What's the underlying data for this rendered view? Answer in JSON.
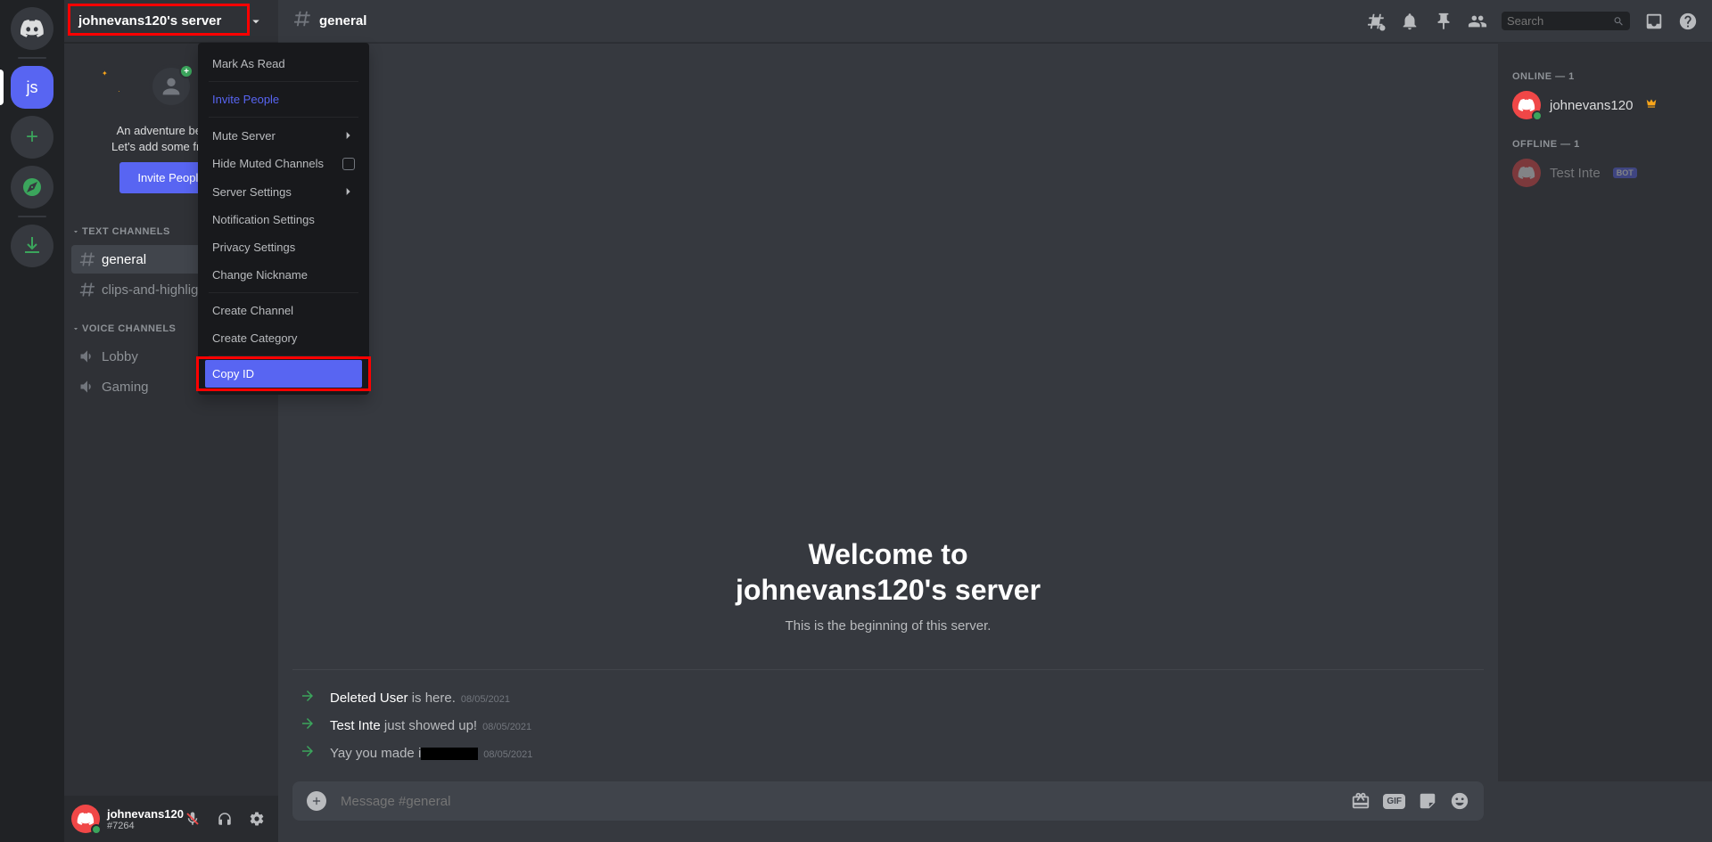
{
  "server": {
    "name": "johnevans120's server",
    "initials": "js"
  },
  "welcome_card": {
    "line1": "An adventure begins.",
    "line2": "Let's add some friends!",
    "button": "Invite People"
  },
  "channel_groups": {
    "text": {
      "label": "TEXT CHANNELS"
    },
    "voice": {
      "label": "VOICE CHANNELS"
    }
  },
  "channels": {
    "text": [
      {
        "name": "general",
        "selected": true
      },
      {
        "name": "clips-and-highlights",
        "selected": false
      }
    ],
    "voice": [
      {
        "name": "Lobby"
      },
      {
        "name": "Gaming"
      }
    ]
  },
  "user_panel": {
    "name": "johnevans120",
    "tag": "#7264"
  },
  "dropdown": {
    "mark_read": "Mark As Read",
    "invite": "Invite People",
    "mute": "Mute Server",
    "hide_muted": "Hide Muted Channels",
    "server_settings": "Server Settings",
    "notif_settings": "Notification Settings",
    "privacy": "Privacy Settings",
    "nickname": "Change Nickname",
    "create_channel": "Create Channel",
    "create_category": "Create Category",
    "copy_id": "Copy ID"
  },
  "chat_header": {
    "channel": "general",
    "search_placeholder": "Search"
  },
  "welcome_msg": {
    "title_line1": "Welcome to",
    "title_line2": "johnevans120's server",
    "subtitle": "This is the beginning of this server."
  },
  "messages": [
    {
      "user": "Deleted User",
      "action": " is here.",
      "date": "08/05/2021"
    },
    {
      "user": "Test Inte",
      "action": " just showed up!",
      "date": "08/05/2021"
    },
    {
      "plain_pre": "Yay you made i",
      "redacted": true,
      "date": "08/05/2021"
    }
  ],
  "input": {
    "placeholder": "Message #general",
    "gif": "GIF"
  },
  "members": {
    "online_header": "ONLINE — 1",
    "offline_header": "OFFLINE — 1",
    "online": [
      {
        "name": "johnevans120",
        "owner": true
      }
    ],
    "offline": [
      {
        "name": "Test Inte",
        "bot": true,
        "bot_label": "BOT"
      }
    ]
  }
}
